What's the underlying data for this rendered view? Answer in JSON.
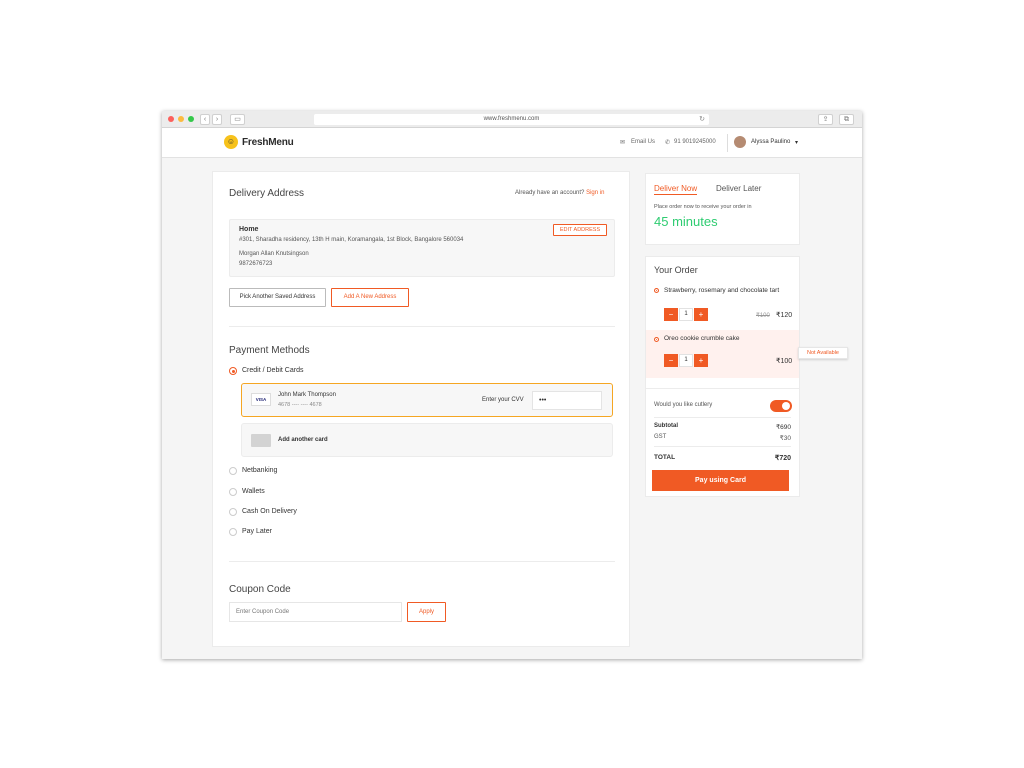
{
  "browser": {
    "url": "www.freshmenu.com"
  },
  "header": {
    "logo": "FreshMenu",
    "email_label": "Email Us",
    "phone": "91 9019245000",
    "user_name": "Alyssa Paulino"
  },
  "delivery": {
    "title": "Delivery Address",
    "account_prompt": "Already have an account?",
    "sign_in": "Sign in",
    "address": {
      "label": "Home",
      "edit": "EDIT ADDRESS",
      "line": "#301, Sharadha residency, 13th H main, Koramangala, 1st Block, Bangalore 560034",
      "name": "Morgan Allan Knutsingson",
      "phone": "9872676723"
    },
    "pick_saved": "Pick Another Saved Address",
    "add_new": "Add A New Address"
  },
  "payment": {
    "title": "Payment Methods",
    "methods": [
      "Credit / Debit Cards",
      "Netbanking",
      "Wallets",
      "Cash On Delivery",
      "Pay Later"
    ],
    "selected": "Credit / Debit Cards",
    "card": {
      "brand": "VISA",
      "holder": "John Mark Thompson",
      "number": "4678 ---- ---- 4678",
      "cvv_label": "Enter your CVV",
      "cvv_value": "•••"
    },
    "add_card": "Add another card"
  },
  "coupon": {
    "title": "Coupon Code",
    "placeholder": "Enter Coupon Code",
    "apply": "Apply"
  },
  "delivery_time": {
    "tab_now": "Deliver Now",
    "tab_later": "Deliver Later",
    "note": "Place order now to receive your order in",
    "eta": "45 minutes"
  },
  "order": {
    "title": "Your Order",
    "items": [
      {
        "name": "Strawberry, rosemary and chocolate tart",
        "qty": "1",
        "old_price": "₹100",
        "price": "₹120"
      },
      {
        "name": "Oreo cookie crumble cake",
        "qty": "1",
        "price": "₹100",
        "badge": "Not Available"
      }
    ],
    "cutlery_label": "Would you like cutlery",
    "cutlery_on": true,
    "subtotal_label": "Subtotal",
    "subtotal": "₹690",
    "gst_label": "GST",
    "gst": "₹30",
    "total_label": "TOTAL",
    "total": "₹720",
    "pay_button": "Pay using Card"
  },
  "colors": {
    "accent": "#f05a24",
    "eta": "#2ecc71",
    "unavailable_bg": "#fff1ee"
  }
}
